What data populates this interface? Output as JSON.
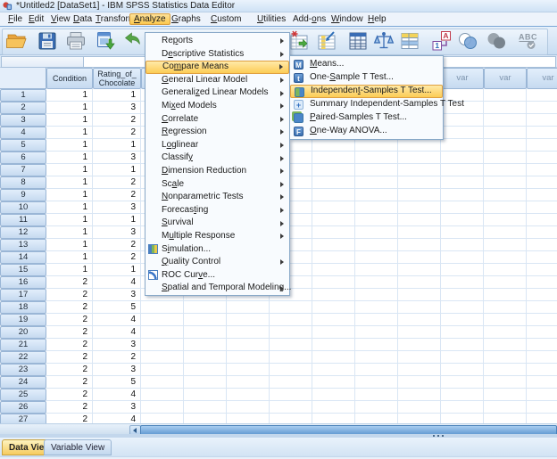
{
  "titlebar": {
    "title": "*Untitled2 [DataSet1] - IBM SPSS Statistics Data Editor"
  },
  "menubar": {
    "items": [
      {
        "label": "File",
        "m": 0
      },
      {
        "label": "Edit",
        "m": 0
      },
      {
        "label": "View",
        "m": 0
      },
      {
        "label": "Data",
        "m": 0
      },
      {
        "label": "Transform",
        "m": 0
      },
      {
        "label": "Analyze",
        "m": 0,
        "active": true
      },
      {
        "label": "Graphs",
        "m": 0
      },
      {
        "label": "Custom",
        "m": 0
      },
      {
        "label": "Utilities",
        "m": 0
      },
      {
        "label": "Add-ons",
        "m": 4
      },
      {
        "label": "Window",
        "m": 0
      },
      {
        "label": "Help",
        "m": 0
      }
    ]
  },
  "toolbar": {
    "icons": [
      "open",
      "save",
      "print",
      "recall-recently-used-dialogs",
      "undo",
      "redo",
      "goto-case",
      "goto-variable",
      "variables",
      "weigh-cases",
      "value-labels",
      "use-variable-sets",
      "select-cases",
      "split-file",
      "spell-check"
    ]
  },
  "analyze_menu": {
    "items": [
      {
        "label": "Reports",
        "m": 2,
        "sub": true
      },
      {
        "label": "Descriptive Statistics",
        "m": 1,
        "sub": true
      },
      {
        "label": "Compare Means",
        "m": 2,
        "sub": true,
        "highlighted": true
      },
      {
        "label": "General Linear Model",
        "m": 0,
        "sub": true
      },
      {
        "label": "Generalized Linear Models",
        "m": 8,
        "sub": true
      },
      {
        "label": "Mixed Models",
        "m": 2,
        "sub": true
      },
      {
        "label": "Correlate",
        "m": 0,
        "sub": true
      },
      {
        "label": "Regression",
        "m": 0,
        "sub": true
      },
      {
        "label": "Loglinear",
        "m": 1,
        "sub": true
      },
      {
        "label": "Classify",
        "m": 7,
        "sub": true
      },
      {
        "label": "Dimension Reduction",
        "m": 0,
        "sub": true
      },
      {
        "label": "Scale",
        "m": 2,
        "sub": true
      },
      {
        "label": "Nonparametric Tests",
        "m": 0,
        "sub": true
      },
      {
        "label": "Forecasting",
        "m": 7,
        "sub": true
      },
      {
        "label": "Survival",
        "m": 0,
        "sub": true
      },
      {
        "label": "Multiple Response",
        "m": 1,
        "sub": true
      },
      {
        "label": "Simulation...",
        "m": 1,
        "sub": false,
        "icon": "simulation-icon"
      },
      {
        "label": "Quality Control",
        "m": 0,
        "sub": true
      },
      {
        "label": "ROC Curve...",
        "m": 7,
        "sub": false,
        "icon": "roc-curve-icon"
      },
      {
        "label": "Spatial and Temporal Modeling...",
        "m": 0,
        "sub": true
      }
    ]
  },
  "compare_means_submenu": {
    "items": [
      {
        "label": "Means...",
        "m": 0,
        "icon": "means-icon",
        "icon_letter": "M"
      },
      {
        "label": "One-Sample T Test...",
        "m": 4,
        "icon": "one-sample-icon",
        "icon_letter": "t"
      },
      {
        "label": "Independent-Samples T Test...",
        "m": 10,
        "icon": "independent-samples-icon",
        "icon_letter": "",
        "highlighted": true
      },
      {
        "label": "Summary Independent-Samples T Test",
        "m": -1,
        "icon": "summary-independent-icon",
        "icon_letter": "+"
      },
      {
        "label": "Paired-Samples T Test...",
        "m": 0,
        "icon": "paired-samples-icon",
        "icon_letter": ""
      },
      {
        "label": "One-Way ANOVA...",
        "m": 0,
        "icon": "one-way-anova-icon",
        "icon_letter": "F"
      }
    ]
  },
  "grid": {
    "columns": [
      {
        "label": "",
        "name": "corner"
      },
      {
        "label": "Condition",
        "name": "condition"
      },
      {
        "label": "Rating_of_Chocolate",
        "name": "rating-of-chocolate"
      }
    ],
    "var_column_label": "var",
    "var_column_count": 10,
    "rows": [
      {
        "n": "1",
        "condition": "1",
        "rating": "1"
      },
      {
        "n": "2",
        "condition": "1",
        "rating": "3"
      },
      {
        "n": "3",
        "condition": "1",
        "rating": "2"
      },
      {
        "n": "4",
        "condition": "1",
        "rating": "2"
      },
      {
        "n": "5",
        "condition": "1",
        "rating": "1"
      },
      {
        "n": "6",
        "condition": "1",
        "rating": "3"
      },
      {
        "n": "7",
        "condition": "1",
        "rating": "1"
      },
      {
        "n": "8",
        "condition": "1",
        "rating": "2"
      },
      {
        "n": "9",
        "condition": "1",
        "rating": "2"
      },
      {
        "n": "10",
        "condition": "1",
        "rating": "3"
      },
      {
        "n": "11",
        "condition": "1",
        "rating": "1"
      },
      {
        "n": "12",
        "condition": "1",
        "rating": "3"
      },
      {
        "n": "13",
        "condition": "1",
        "rating": "2"
      },
      {
        "n": "14",
        "condition": "1",
        "rating": "2"
      },
      {
        "n": "15",
        "condition": "1",
        "rating": "1"
      },
      {
        "n": "16",
        "condition": "2",
        "rating": "4"
      },
      {
        "n": "17",
        "condition": "2",
        "rating": "3"
      },
      {
        "n": "18",
        "condition": "2",
        "rating": "5"
      },
      {
        "n": "19",
        "condition": "2",
        "rating": "4"
      },
      {
        "n": "20",
        "condition": "2",
        "rating": "4"
      },
      {
        "n": "21",
        "condition": "2",
        "rating": "3"
      },
      {
        "n": "22",
        "condition": "2",
        "rating": "2"
      },
      {
        "n": "23",
        "condition": "2",
        "rating": "3"
      },
      {
        "n": "24",
        "condition": "2",
        "rating": "5"
      },
      {
        "n": "25",
        "condition": "2",
        "rating": "4"
      },
      {
        "n": "26",
        "condition": "2",
        "rating": "3"
      },
      {
        "n": "27",
        "condition": "2",
        "rating": "4"
      }
    ]
  },
  "tabs": {
    "data_view": {
      "label": "Data View",
      "active": true
    },
    "variable_view": {
      "label": "Variable View",
      "active": false
    }
  },
  "colors": {
    "menu_highlight": "#fccc55",
    "menu_highlight_border": "#dfa040",
    "header_blue": "#c6daf0",
    "grid_line": "#d9e6f4",
    "scrollbar_thumb": "#5e97d0",
    "active_tab": "#f6cb5e"
  }
}
